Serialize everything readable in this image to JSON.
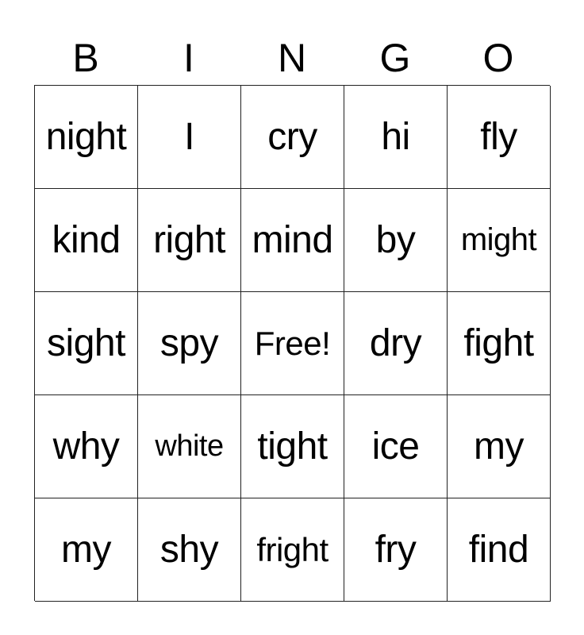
{
  "header": {
    "letters": [
      "B",
      "I",
      "N",
      "G",
      "O"
    ]
  },
  "card": {
    "rows": [
      [
        "night",
        "I",
        "cry",
        "hi",
        "fly"
      ],
      [
        "kind",
        "right",
        "mind",
        "by",
        "might"
      ],
      [
        "sight",
        "spy",
        "Free!",
        "dry",
        "fight"
      ],
      [
        "why",
        "white",
        "tight",
        "ice",
        "my"
      ],
      [
        "my",
        "shy",
        "fright",
        "fry",
        "find"
      ]
    ],
    "free_space": "Free!"
  }
}
